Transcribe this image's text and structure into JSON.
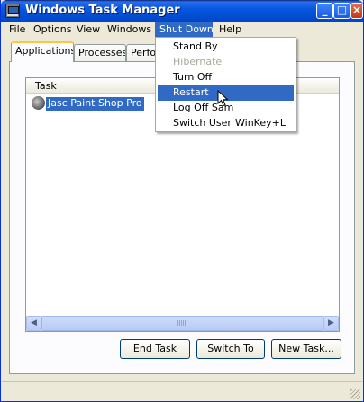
{
  "window": {
    "title": "Windows Task Manager",
    "icon": "task-manager-icon",
    "controls": {
      "minimize": "_",
      "maximize": "□",
      "close": "×"
    }
  },
  "menubar": {
    "items": [
      {
        "label": "File"
      },
      {
        "label": "Options"
      },
      {
        "label": "View"
      },
      {
        "label": "Windows"
      },
      {
        "label": "Shut Down",
        "active": true
      },
      {
        "label": "Help"
      }
    ]
  },
  "tabs": [
    {
      "label": "Applications",
      "selected": true
    },
    {
      "label": "Processes"
    },
    {
      "label": "Perfo"
    }
  ],
  "tasklist": {
    "column": "Task",
    "rows": [
      {
        "name": "Jasc Paint Shop Pro",
        "selected": true
      }
    ]
  },
  "shutdown_menu": {
    "items": [
      {
        "label": "Stand By"
      },
      {
        "label": "Hibernate",
        "disabled": true
      },
      {
        "label": "Turn Off"
      },
      {
        "label": "Restart",
        "highlighted": true
      },
      {
        "label": "Log Off Sam"
      },
      {
        "label": "Switch User",
        "shortcut": "WinKey+L"
      }
    ]
  },
  "buttons": {
    "end_task": "End Task",
    "switch_to": "Switch To",
    "new_task": "New Task..."
  },
  "colors": {
    "title_bar": "#0451d8",
    "menu_highlight": "#316ac5",
    "disabled_text": "#aca899",
    "window_bg": "#ece9d8"
  }
}
